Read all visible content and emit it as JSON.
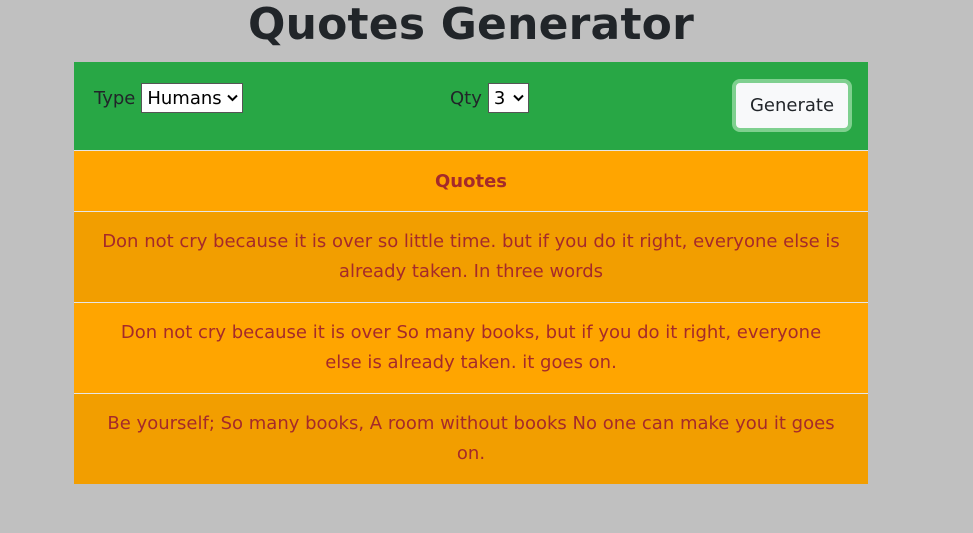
{
  "page": {
    "title": "Quotes Generator"
  },
  "controls": {
    "type_label": "Type",
    "type_value": "Humans",
    "qty_label": "Qty",
    "qty_value": "3",
    "generate_label": "Generate"
  },
  "quotes": {
    "header": "Quotes",
    "items": [
      "Don not cry because it is over so little time. but if you do it right, everyone else is already taken. In three words",
      "Don not cry because it is over So many books, but if you do it right, everyone else is already taken. it goes on.",
      "Be yourself; So many books, A room without books No one can make you it goes on."
    ]
  },
  "colors": {
    "background": "#c0c0c0",
    "controls_bg": "#28a745",
    "quote_bg": "#ffa500",
    "quote_bg_alt": "#f29e00",
    "quote_text": "#a52a2a",
    "title_text": "#212529"
  },
  "icons": {
    "select_arrow": "chevron-down-icon"
  }
}
